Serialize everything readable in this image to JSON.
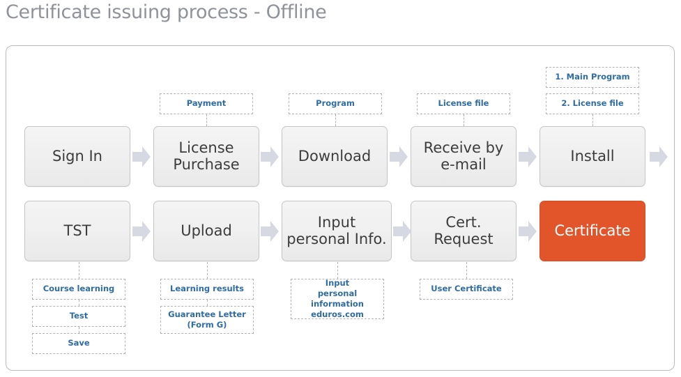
{
  "page": {
    "title": "Certificate issuing process - Offline",
    "accent_color": "#e2552a",
    "annotation_text_color": "#2f6ca3",
    "box_fill_color": "#efefef",
    "box_border_color": "#c3c5c7",
    "arrow_color": "#d6d9e2"
  },
  "rows": [
    {
      "name": "row-1",
      "steps": [
        {
          "label": "Sign In",
          "annotations": []
        },
        {
          "label": "License\nPurchase",
          "label_lines": [
            "License",
            "Purchase"
          ],
          "annotations": [
            {
              "text": "Payment",
              "lines": [
                "Payment"
              ]
            }
          ]
        },
        {
          "label": "Download",
          "annotations": [
            {
              "text": "Program",
              "lines": [
                "Program"
              ]
            }
          ]
        },
        {
          "label": "Receive by\ne-mail",
          "label_lines": [
            "Receive by",
            "e-mail"
          ],
          "annotations": [
            {
              "text": "License file",
              "lines": [
                "License file"
              ]
            }
          ]
        },
        {
          "label": "Install",
          "annotations": [
            {
              "text": "1. Main Program",
              "lines": [
                "1. Main Program"
              ]
            },
            {
              "text": "2. License file",
              "lines": [
                "2. License file"
              ]
            }
          ]
        }
      ]
    },
    {
      "name": "row-2",
      "steps": [
        {
          "label": "TST",
          "annotations": [
            {
              "text": "Course learning",
              "lines": [
                "Course learning"
              ]
            },
            {
              "text": "Test",
              "lines": [
                "Test"
              ]
            },
            {
              "text": "Save",
              "lines": [
                "Save"
              ]
            }
          ]
        },
        {
          "label": "Upload",
          "annotations": [
            {
              "text": "Learning results",
              "lines": [
                "Learning results"
              ]
            },
            {
              "text": "Guarantee Letter\n(Form G)",
              "lines": [
                "Guarantee Letter",
                "(Form G)"
              ]
            }
          ]
        },
        {
          "label": "Input\npersonal Info.",
          "label_lines": [
            "Input",
            "personal Info."
          ],
          "annotations": [
            {
              "text": "Input\npersonal information\neduros.com",
              "lines": [
                "Input",
                "personal information",
                "eduros.com"
              ]
            }
          ]
        },
        {
          "label": "Cert.\nRequest",
          "label_lines": [
            "Cert.",
            "Request"
          ],
          "annotations": [
            {
              "text": "User Certificate",
              "lines": [
                "User Certificate"
              ]
            }
          ]
        },
        {
          "label": "Certificate",
          "accent": true,
          "annotations": []
        }
      ]
    }
  ],
  "labels": {
    "r1s1": "Sign In",
    "r1s2_l1": "License",
    "r1s2_l2": "Purchase",
    "r1s3": "Download",
    "r1s4_l1": "Receive by",
    "r1s4_l2": "e-mail",
    "r1s5": "Install",
    "r2s1": "TST",
    "r2s2": "Upload",
    "r2s3_l1": "Input",
    "r2s3_l2": "personal Info.",
    "r2s4_l1": "Cert.",
    "r2s4_l2": "Request",
    "r2s5": "Certificate",
    "a_payment": "Payment",
    "a_program": "Program",
    "a_license_file": "License file",
    "a_main_program": "1. Main Program",
    "a_license_file_2": "2. License file",
    "a_course_learning": "Course learning",
    "a_test": "Test",
    "a_save": "Save",
    "a_learning_results": "Learning results",
    "a_guarantee_1": "Guarantee Letter",
    "a_guarantee_2": "(Form G)",
    "a_input_1": "Input",
    "a_input_2": "personal information",
    "a_input_3": "eduros.com",
    "a_user_certificate": "User Certificate"
  }
}
